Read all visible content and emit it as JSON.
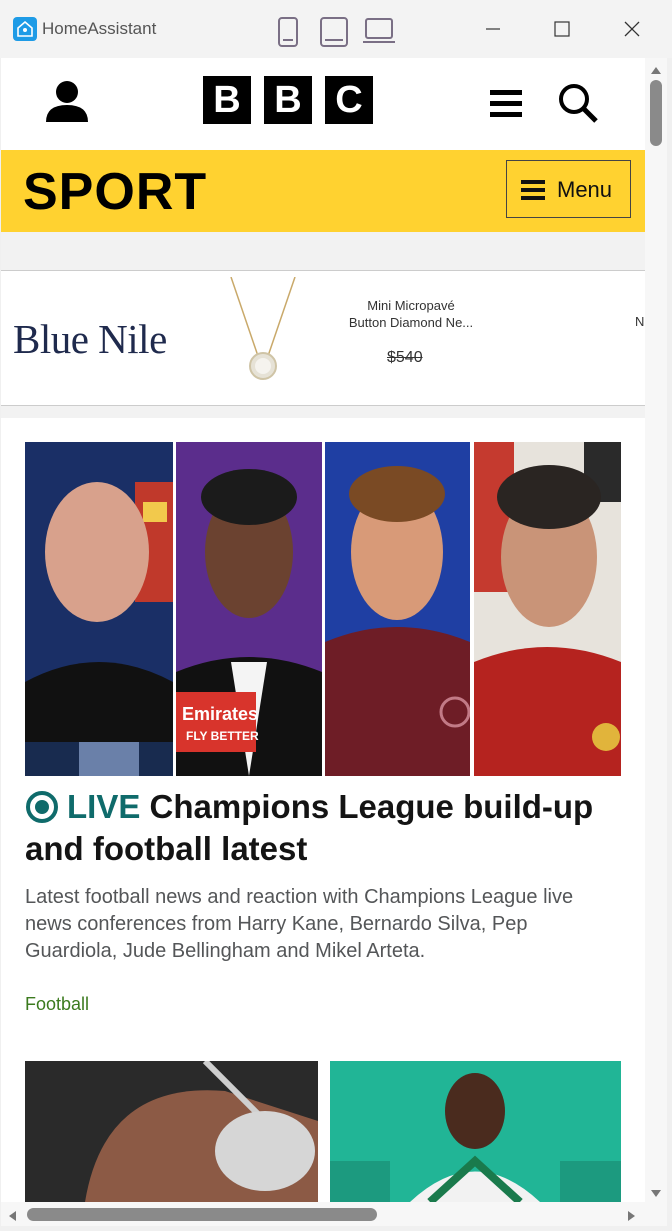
{
  "window": {
    "app_title": "HomeAssistant",
    "device_icons": [
      "phone-view-icon",
      "tablet-view-icon",
      "laptop-view-icon"
    ],
    "controls": [
      "minimize-icon",
      "maximize-icon",
      "close-icon"
    ]
  },
  "bbc": {
    "logo_letters": [
      "B",
      "B",
      "C"
    ],
    "icons": [
      "account-icon",
      "hamburger-icon",
      "search-icon"
    ]
  },
  "sport": {
    "title": "SPORT",
    "menu_label": "Menu",
    "bar_color": "#ffd230"
  },
  "ad": {
    "brand": "Blue Nile",
    "product_title_line1": "Mini Micropavé",
    "product_title_line2": "Button Diamond Ne...",
    "product_price": "$540",
    "next_item_cut": "N"
  },
  "article": {
    "live_label": "LIVE",
    "title": "Champions League build-up and football latest",
    "summary": "Latest football news and reaction with Champions League live news conferences from Harry Kane, Bernardo Silva, Pep Guardiola, Jude Bellingham and Mikel Arteta.",
    "tag": "Football",
    "live_color": "#0f6b6b",
    "tag_color": "#3b7a1e"
  }
}
